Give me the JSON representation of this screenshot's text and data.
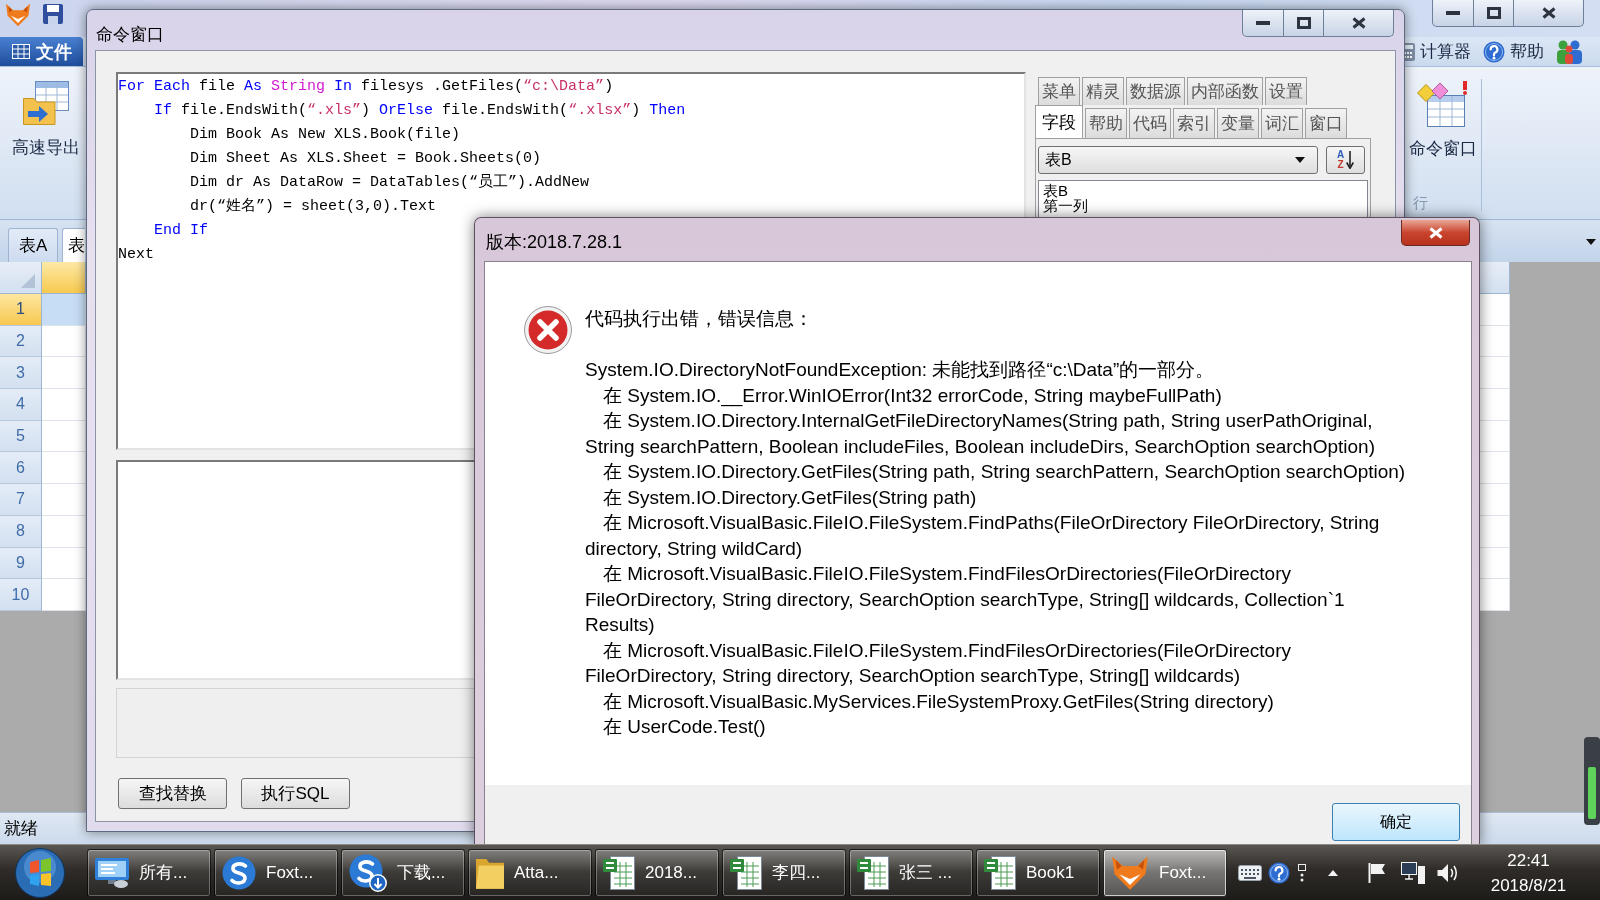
{
  "main_window": {
    "file_menu": {
      "label": "文件"
    },
    "ribbon_links": [
      {
        "label": "计算器",
        "kind": "calculator"
      },
      {
        "label": "帮助",
        "kind": "help"
      }
    ],
    "ribbon_left_buttons": [
      {
        "label": "高速导出",
        "kind": "export"
      }
    ],
    "ribbon_right_buttons": [
      {
        "label": "命令窗口",
        "kind": "command"
      }
    ],
    "ribbon_group_label": "行",
    "sheet_tabs": [
      {
        "label": "表A",
        "selected": false
      },
      {
        "label": "表",
        "selected": true
      }
    ],
    "grid_columns": [
      {
        "selected": true
      },
      {
        "selected": false
      }
    ],
    "grid_rows": [
      {
        "number": "1",
        "selected": true
      },
      {
        "number": "2",
        "selected": false
      },
      {
        "number": "3",
        "selected": false
      },
      {
        "number": "4",
        "selected": false
      },
      {
        "number": "5",
        "selected": false
      },
      {
        "number": "6",
        "selected": false
      },
      {
        "number": "7",
        "selected": false
      },
      {
        "number": "8",
        "selected": false
      },
      {
        "number": "9",
        "selected": false
      },
      {
        "number": "10",
        "selected": false
      }
    ],
    "status_bar": "就绪"
  },
  "command_window": {
    "title": "命令窗口",
    "code_lines": [
      {
        "tokens": [
          {
            "text": "For Each",
            "kind": "keyword"
          },
          {
            "text": " file ",
            "kind": "plain"
          },
          {
            "text": "As",
            "kind": "keyword"
          },
          {
            "text": " String",
            "kind": "type"
          },
          {
            "text": " In",
            "kind": "keyword"
          },
          {
            "text": " filesys .GetFiles(",
            "kind": "plain"
          },
          {
            "text": "“c:\\Data”",
            "kind": "string"
          },
          {
            "text": ")",
            "kind": "plain"
          }
        ]
      },
      {
        "tokens": [
          {
            "text": "    If",
            "kind": "keyword"
          },
          {
            "text": " file.EndsWith(",
            "kind": "plain"
          },
          {
            "text": "“.xls”",
            "kind": "string"
          },
          {
            "text": ")",
            "kind": "plain"
          },
          {
            "text": " OrElse",
            "kind": "keyword"
          },
          {
            "text": " file.EndsWith(",
            "kind": "plain"
          },
          {
            "text": "“.xlsx”",
            "kind": "string"
          },
          {
            "text": ")",
            "kind": "plain"
          },
          {
            "text": " Then",
            "kind": "keyword"
          }
        ]
      },
      {
        "tokens": [
          {
            "text": "        Dim Book As New XLS.Book(file)",
            "kind": "plain"
          }
        ]
      },
      {
        "tokens": [
          {
            "text": "        Dim Sheet As XLS.Sheet = Book.Sheets(0)",
            "kind": "plain"
          }
        ]
      },
      {
        "tokens": [
          {
            "text": "        Dim dr As DataRow = DataTables(“员工”).AddNew",
            "kind": "plain"
          }
        ]
      },
      {
        "tokens": [
          {
            "text": "        dr(“姓名”) = sheet(3,0).Text",
            "kind": "plain"
          }
        ]
      },
      {
        "tokens": [
          {
            "text": "    End If",
            "kind": "keyword"
          }
        ]
      },
      {
        "tokens": [
          {
            "text": "Next",
            "kind": "plain"
          }
        ]
      }
    ],
    "buttons": [
      {
        "label": "查找替换"
      },
      {
        "label": "执行SQL"
      }
    ],
    "panel_tab_rows": [
      [
        {
          "label": "菜单",
          "selected": false
        },
        {
          "label": "精灵",
          "selected": false
        },
        {
          "label": "数据源",
          "selected": false
        },
        {
          "label": "内部函数",
          "selected": false
        },
        {
          "label": "设置",
          "selected": false
        }
      ],
      [
        {
          "label": "字段",
          "selected": true
        },
        {
          "label": "帮助",
          "selected": false
        },
        {
          "label": "代码",
          "selected": false
        },
        {
          "label": "索引",
          "selected": false
        },
        {
          "label": "变量",
          "selected": false
        },
        {
          "label": "词汇",
          "selected": false
        },
        {
          "label": "窗口",
          "selected": false
        }
      ]
    ],
    "table_select": {
      "value": "表B"
    },
    "sort_button": {
      "top_letter": "A",
      "bottom_letter": "Z"
    },
    "field_list": [
      {
        "label": "表B"
      },
      {
        "label": "第一列"
      }
    ]
  },
  "error_dialog": {
    "title": "版本:2018.7.28.1",
    "heading": "代码执行出错，错误信息：",
    "message": "System.IO.DirectoryNotFoundException: 未能找到路径“c:\\Data”的一部分。",
    "stack_frames": [
      "在 System.IO.__Error.WinIOError(Int32 errorCode, String maybeFullPath)",
      "在 System.IO.Directory.InternalGetFileDirectoryNames(String path, String userPathOriginal, String searchPattern, Boolean includeFiles, Boolean includeDirs, SearchOption searchOption)",
      "在 System.IO.Directory.GetFiles(String path, String searchPattern, SearchOption searchOption)",
      "在 System.IO.Directory.GetFiles(String path)",
      "在 Microsoft.VisualBasic.FileIO.FileSystem.FindPaths(FileOrDirectory FileOrDirectory, String directory, String wildCard)",
      "在 Microsoft.VisualBasic.FileIO.FileSystem.FindFilesOrDirectories(FileOrDirectory FileOrDirectory, String directory, SearchOption searchType, String[] wildcards, Collection`1 Results)",
      "在 Microsoft.VisualBasic.FileIO.FileSystem.FindFilesOrDirectories(FileOrDirectory FileOrDirectory, String directory, SearchOption searchType, String[] wildcards)",
      "在 Microsoft.VisualBasic.MyServices.FileSystemProxy.GetFiles(String directory)",
      "在 UserCode.Test()"
    ],
    "ok_button": "确定"
  },
  "taskbar": {
    "items": [
      {
        "label": "所有...",
        "kind": "panel",
        "selected": false
      },
      {
        "label": "Foxt...",
        "kind": "browser",
        "selected": false
      },
      {
        "label": "下载...",
        "kind": "download",
        "selected": false
      },
      {
        "label": "Atta...",
        "kind": "folder",
        "selected": false
      },
      {
        "label": "2018...",
        "kind": "spreadsheet",
        "selected": false
      },
      {
        "label": "李四...",
        "kind": "spreadsheet",
        "selected": false
      },
      {
        "label": "张三 ...",
        "kind": "spreadsheet",
        "selected": false
      },
      {
        "label": "Book1",
        "kind": "spreadsheet",
        "selected": false
      },
      {
        "label": "Foxt...",
        "kind": "fox",
        "selected": true
      }
    ],
    "clock": {
      "time": "22:41",
      "date": "2018/8/21"
    }
  }
}
